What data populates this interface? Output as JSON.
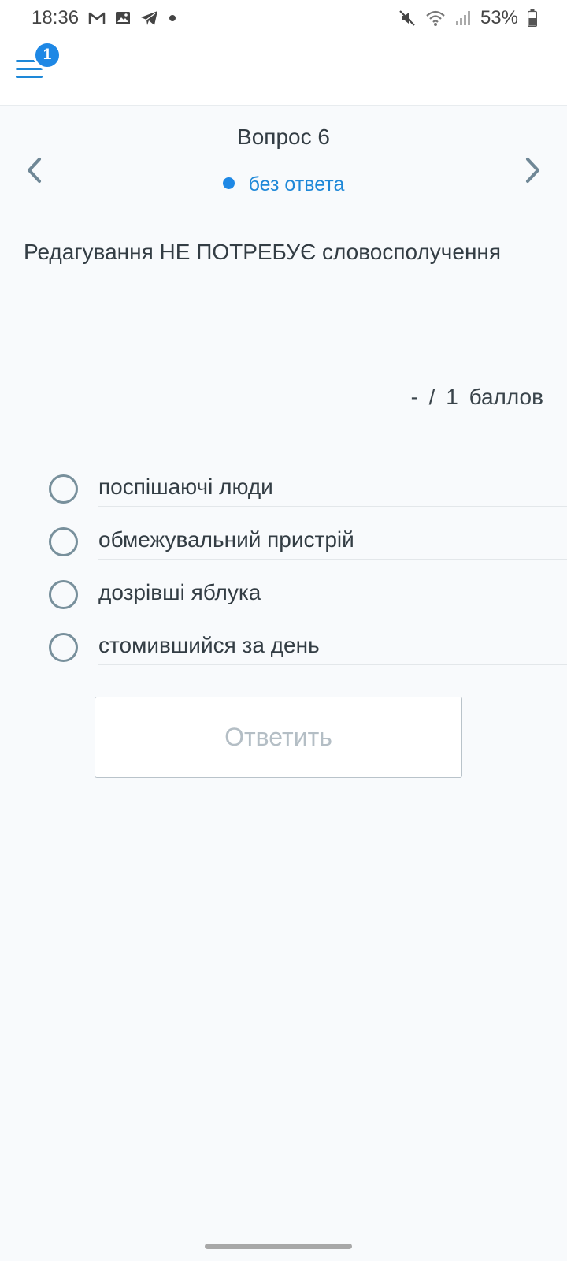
{
  "status_bar": {
    "time": "18:36",
    "notification_icons": [
      "gmail-icon",
      "gallery-icon",
      "telegram-icon",
      "dot-icon"
    ],
    "system_icons": [
      "mute-icon",
      "wifi-icon",
      "signal-icon"
    ],
    "battery": "53%"
  },
  "header": {
    "menu_icon": "hamburger-menu-icon",
    "notification_badge": "1"
  },
  "question": {
    "title": "Вопрос 6",
    "status": "без ответа",
    "text": "Редагування НЕ ПОТРЕБУЄ словосполучення",
    "score": "- / 1 баллов"
  },
  "options": [
    {
      "label": "поспішаючі люди",
      "selected": false
    },
    {
      "label": "обмежувальний пристрій",
      "selected": false
    },
    {
      "label": "дозрівші яблука",
      "selected": false
    },
    {
      "label": "стомившийся за день",
      "selected": false
    }
  ],
  "actions": {
    "submit_label": "Ответить"
  },
  "colors": {
    "accent": "#1e88e5",
    "background": "#f8fafc",
    "text": "#333d44"
  }
}
